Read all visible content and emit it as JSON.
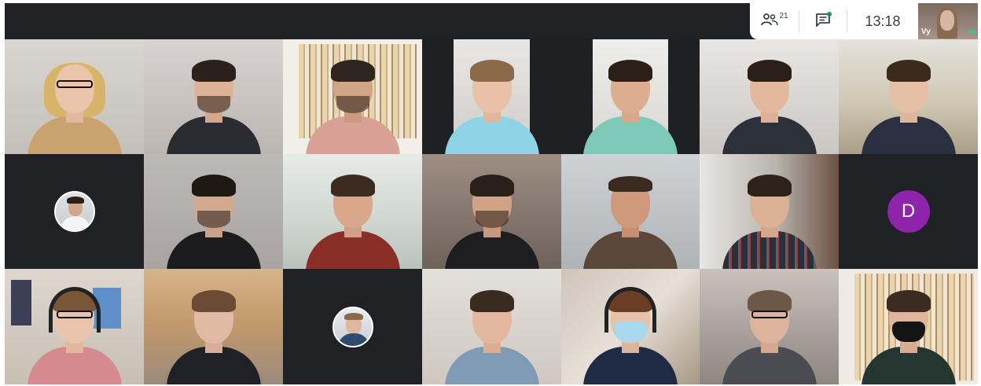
{
  "top_bar": {
    "people_count": "21",
    "clock": "13:18",
    "self_view": {
      "name": "Vy"
    }
  },
  "icons": {
    "people": "people-icon",
    "chat": "chat-icon",
    "more": "more-options-icon"
  },
  "colors": {
    "stage_background": "#202124",
    "chat_indicator": "#1a8c7a",
    "letter_avatar": "#8e24aa",
    "self_more_dots": "#25d0a6"
  },
  "participants": [
    {
      "tile": 1,
      "kind": "video"
    },
    {
      "tile": 2,
      "kind": "video"
    },
    {
      "tile": 3,
      "kind": "video"
    },
    {
      "tile": 4,
      "kind": "video"
    },
    {
      "tile": 5,
      "kind": "video"
    },
    {
      "tile": 6,
      "kind": "video"
    },
    {
      "tile": 7,
      "kind": "video"
    },
    {
      "tile": 8,
      "kind": "profile-photo"
    },
    {
      "tile": 9,
      "kind": "video"
    },
    {
      "tile": 10,
      "kind": "video"
    },
    {
      "tile": 11,
      "kind": "video"
    },
    {
      "tile": 12,
      "kind": "video"
    },
    {
      "tile": 13,
      "kind": "video"
    },
    {
      "tile": 14,
      "kind": "letter-avatar",
      "initial": "D"
    },
    {
      "tile": 15,
      "kind": "video"
    },
    {
      "tile": 16,
      "kind": "video"
    },
    {
      "tile": 17,
      "kind": "profile-photo"
    },
    {
      "tile": 18,
      "kind": "video"
    },
    {
      "tile": 19,
      "kind": "video"
    },
    {
      "tile": 20,
      "kind": "video"
    },
    {
      "tile": 21,
      "kind": "video"
    }
  ]
}
